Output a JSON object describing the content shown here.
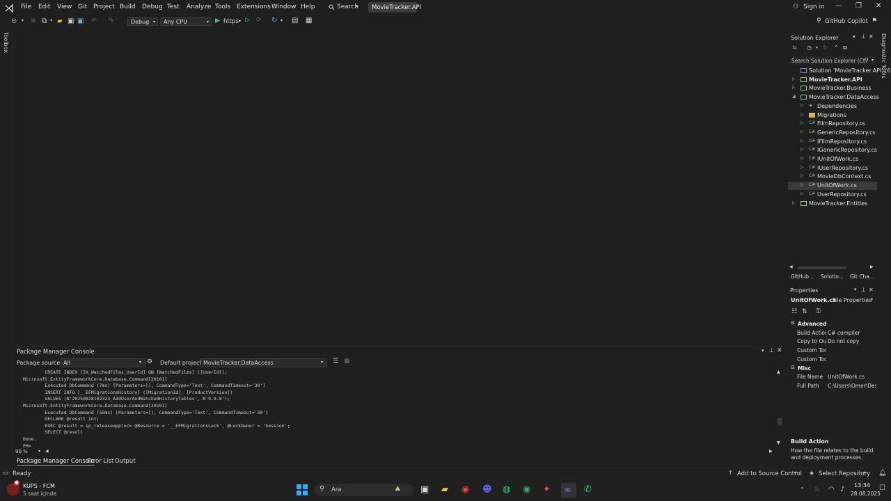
{
  "menu": {
    "items": [
      "File",
      "Edit",
      "View",
      "Git",
      "Project",
      "Build",
      "Debug",
      "Test",
      "Analyze",
      "Tools",
      "Extensions",
      "Window",
      "Help"
    ],
    "search_label": "Search",
    "active_project": "MovieTracker.API",
    "sign_in": "Sign in",
    "copilot": "GitHub Copilot"
  },
  "toolbar": {
    "configuration": "Debug",
    "platform": "Any CPU",
    "run_profile": "https"
  },
  "side_labels": {
    "left": "Toolbox",
    "right": "Diagnostic Tools"
  },
  "solution_explorer": {
    "title": "Solution Explorer",
    "search_placeholder": "Search Solution Explorer (Ct",
    "items": [
      {
        "label": "Solution 'MovieTracker.API' (6",
        "indent": 0,
        "expander": "",
        "icon": "solution-icon"
      },
      {
        "label": "MovieTracker.API",
        "indent": 0,
        "expander": "▷",
        "icon": "project-icon",
        "bold": true
      },
      {
        "label": "MovieTracker.Business",
        "indent": 0,
        "expander": "▷",
        "icon": "project-icon"
      },
      {
        "label": "MovieTracker.DataAccess",
        "indent": 0,
        "expander": "◢",
        "icon": "project-icon"
      },
      {
        "label": "Dependencies",
        "indent": 1,
        "expander": "▷",
        "icon": "dependencies-icon"
      },
      {
        "label": "Migrations",
        "indent": 1,
        "expander": "▷",
        "icon": "folder-icon"
      },
      {
        "label": "FilmRepository.cs",
        "indent": 1,
        "expander": "▷",
        "icon": "csharp-file-icon"
      },
      {
        "label": "GenericRepository.cs",
        "indent": 1,
        "expander": "▷",
        "icon": "csharp-file-icon"
      },
      {
        "label": "IFilmRepository.cs",
        "indent": 1,
        "expander": "▷",
        "icon": "csharp-file-icon"
      },
      {
        "label": "IGenericRepository.cs",
        "indent": 1,
        "expander": "▷",
        "icon": "csharp-file-icon"
      },
      {
        "label": "IUnitOfWork.cs",
        "indent": 1,
        "expander": "▷",
        "icon": "csharp-file-icon"
      },
      {
        "label": "IUserRepository.cs",
        "indent": 1,
        "expander": "▷",
        "icon": "csharp-file-icon"
      },
      {
        "label": "MovieDbContext.cs",
        "indent": 1,
        "expander": "▷",
        "icon": "csharp-file-icon"
      },
      {
        "label": "UnitOfWork.cs",
        "indent": 1,
        "expander": "▷",
        "icon": "csharp-file-icon",
        "selected": true
      },
      {
        "label": "UserRepository.cs",
        "indent": 1,
        "expander": "▷",
        "icon": "csharp-file-icon"
      },
      {
        "label": "MovieTracker.Entities",
        "indent": 0,
        "expander": "▷",
        "icon": "project-icon"
      }
    ],
    "bottom_tabs": [
      "GitHub...",
      "Solutio...",
      "Git Cha..."
    ]
  },
  "properties": {
    "title": "Properties",
    "object_name": "UnitOfWork.cs",
    "object_type": "File Properties",
    "sections": [
      {
        "name": "Advanced",
        "rows": [
          {
            "key": "Build Action",
            "value": "C# compiler"
          },
          {
            "key": "Copy to Ou",
            "value": "Do not copy"
          },
          {
            "key": "Custom Too",
            "value": ""
          },
          {
            "key": "Custom Too",
            "value": ""
          }
        ]
      },
      {
        "name": "Misc",
        "rows": [
          {
            "key": "File Name",
            "value": "UnitOfWork.cs"
          },
          {
            "key": "Full Path",
            "value": "C:\\Users\\Omer\\Des"
          }
        ]
      }
    ],
    "description_title": "Build Action",
    "description_text_1": "How the file relates to the build",
    "description_text_2": "and deployment processes."
  },
  "package_manager": {
    "title": "Package Manager Console",
    "source_label": "Package source:",
    "source_value": "All",
    "default_project_label": "Default project:",
    "default_project_value": "MovieTracker.DataAccess",
    "lines": [
      "        CREATE INDEX [IX_WatchedFilms_UserId] ON [WatchedFilms] ([UserId]);",
      "Microsoft.EntityFrameworkCore.Database.Command[20101]",
      "        Executed DbCommand (7ms) [Parameters=[], CommandType='Text', CommandTimeout='30']",
      "        INSERT INTO [__EFMigrationsHistory] ([MigrationId], [ProductVersion])",
      "        VALUES (N'20250828102323_AddUserAndWatchedHistoryTables', N'9.0.8');",
      "Microsoft.EntityFrameworkCore.Database.Command[20101]",
      "        Executed DbCommand (59ms) [Parameters=[], CommandType='Text', CommandTimeout='30']",
      "        DECLARE @result int;",
      "        EXEC @result = sp_releaseapplock @Resource = '__EFMigrationsLock', @LockOwner = 'Session';",
      "        SELECT @result",
      "Done.",
      "PM>"
    ],
    "zoom": "90 %",
    "bottom_tabs": [
      "Package Manager Console",
      "Error List",
      "Output"
    ]
  },
  "status": {
    "ready": "Ready",
    "add_source_control": "Add to Source Control",
    "select_repository": "Select Repository"
  },
  "taskbar": {
    "notification_title": "KUPS - FCM",
    "notification_sub": "5 saat içinde",
    "search_placeholder": "Ara",
    "time": "13:34",
    "date": "28.08.2025"
  },
  "colors": {
    "accent": "#5a3f9c",
    "background": "#1f1f1f",
    "text": "#e0e0e0"
  }
}
